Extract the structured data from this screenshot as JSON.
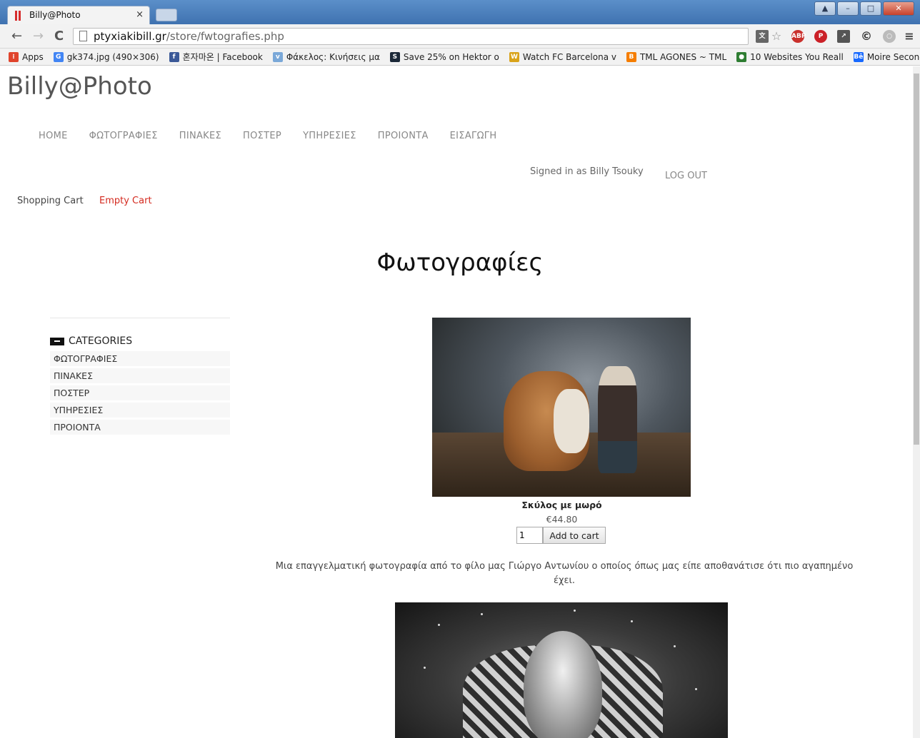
{
  "browser": {
    "tab_title": "Billy@Photo",
    "tab_close": "×",
    "url_host": "ptyxiakibill.gr",
    "url_path": "/store/fwtografies.php",
    "bookmarks": [
      {
        "label": "Apps",
        "color": "#e0442c"
      },
      {
        "label": "gk374.jpg (490×306)",
        "color": "#4285f4"
      },
      {
        "label": "혼자마온 | Facebook",
        "color": "#3b5998"
      },
      {
        "label": "Φάκελος: Κινήσεις μα",
        "color": "#7aa8d8"
      },
      {
        "label": "Save 25% on Hektor o",
        "color": "#1b2838"
      },
      {
        "label": "Watch FC Barcelona v",
        "color": "#d9a31a"
      },
      {
        "label": "TML AGONES ~ TML",
        "color": "#f57d00"
      },
      {
        "label": "10 Websites You Reall",
        "color": "#2e7d32"
      },
      {
        "label": "Moire Seconds Clock",
        "color": "#1769ff"
      }
    ],
    "bookmarks_more": "»"
  },
  "site": {
    "logo": "Billy@Photo",
    "nav": [
      "HOME",
      "ΦΩΤΟΓΡΑΦΙΕΣ",
      "ΠΙΝΑΚΕΣ",
      "ΠΟΣΤΕΡ",
      "ΥΠΗΡΕΣΙΕΣ",
      "ΠΡΟΙΟΝΤΑ",
      "ΕΙΣΑΓΩΓΗ"
    ],
    "signed_in": "Signed in as Billy Tsouky",
    "logout": "LOG OUT",
    "cart_label": "Shopping Cart",
    "empty_cart": "Empty Cart",
    "page_heading": "Φωτογραφίες"
  },
  "sidebar": {
    "heading": "CATEGORIES",
    "items": [
      "ΦΩΤΟΓΡΑΦΙΕΣ",
      "ΠΙΝΑΚΕΣ",
      "ΠΟΣΤΕΡ",
      "ΥΠΗΡΕΣΙΕΣ",
      "ΠΡΟΙΟΝΤΑ"
    ]
  },
  "products": [
    {
      "name": "Σκύλος με μωρό",
      "price": "€44.80",
      "qty": "1",
      "add_label": "Add to cart",
      "description": "Μια επαγγελματική φωτογραφία από το φίλο μας Γιώργο Αντωνίου ο οποίος όπως μας είπε αποθανάτισε ότι πιο αγαπημένο έχει."
    }
  ]
}
